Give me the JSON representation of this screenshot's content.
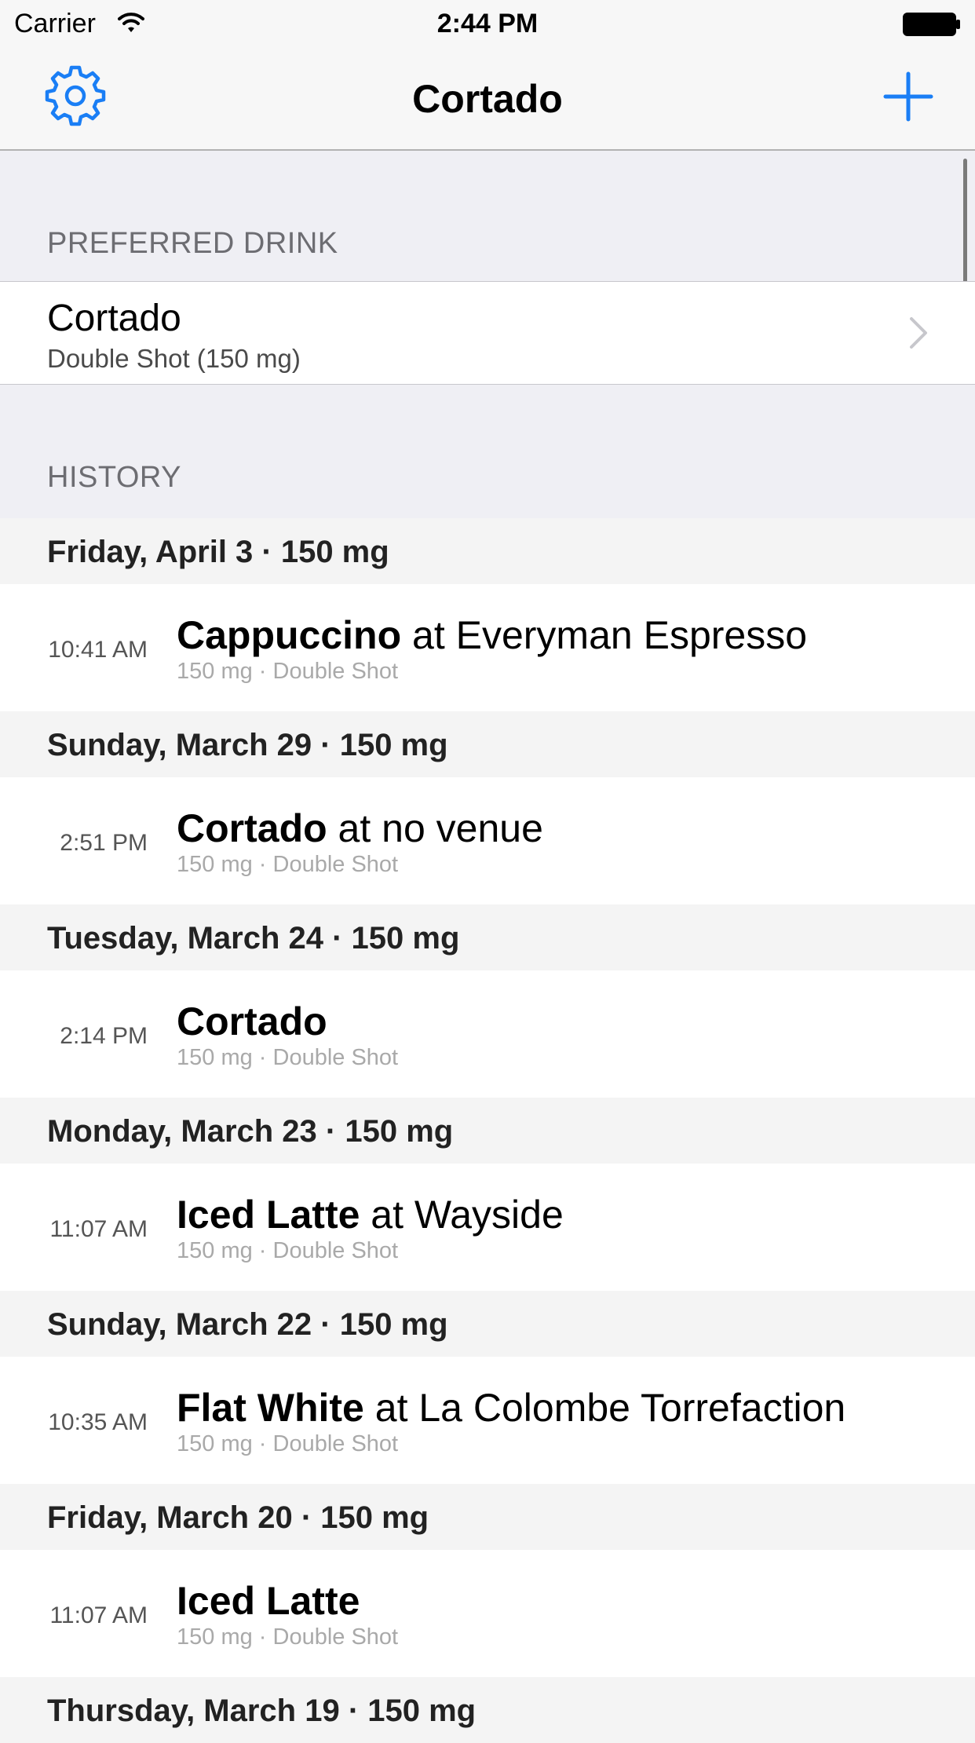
{
  "status_bar": {
    "carrier": "Carrier",
    "time": "2:44 PM"
  },
  "nav": {
    "title": "Cortado"
  },
  "preferred": {
    "section_label": "PREFERRED DRINK",
    "drink_name": "Cortado",
    "drink_detail": "Double Shot (150 mg)"
  },
  "history": {
    "section_label": "HISTORY",
    "days": [
      {
        "header": "Friday, April 3 · 150 mg",
        "entries": [
          {
            "time": "10:41 AM",
            "drink": "Cappuccino",
            "venue": " at Everyman Espresso",
            "detail": "150 mg · Double Shot"
          }
        ]
      },
      {
        "header": "Sunday, March 29 · 150 mg",
        "entries": [
          {
            "time": "2:51 PM",
            "drink": "Cortado",
            "venue": " at no venue",
            "detail": "150 mg · Double Shot"
          }
        ]
      },
      {
        "header": "Tuesday, March 24 · 150 mg",
        "entries": [
          {
            "time": "2:14 PM",
            "drink": "Cortado",
            "venue": "",
            "detail": "150 mg · Double Shot"
          }
        ]
      },
      {
        "header": "Monday, March 23 · 150 mg",
        "entries": [
          {
            "time": "11:07 AM",
            "drink": "Iced Latte",
            "venue": " at Wayside",
            "detail": "150 mg · Double Shot"
          }
        ]
      },
      {
        "header": "Sunday, March 22 · 150 mg",
        "entries": [
          {
            "time": "10:35 AM",
            "drink": "Flat White",
            "venue": " at La Colombe Torrefaction",
            "detail": "150 mg · Double Shot"
          }
        ]
      },
      {
        "header": "Friday, March 20 · 150 mg",
        "entries": [
          {
            "time": "11:07 AM",
            "drink": "Iced Latte",
            "venue": "",
            "detail": "150 mg · Double Shot"
          }
        ]
      },
      {
        "header": "Thursday, March 19 · 150 mg",
        "entries": []
      }
    ]
  },
  "icons": {
    "settings": "gear-icon",
    "add": "plus-icon",
    "disclosure": "chevron-right-icon",
    "wifi": "wifi-icon",
    "battery": "battery-icon"
  },
  "colors": {
    "accent": "#1a7ef5",
    "section_text": "#6d6d72",
    "group_background": "#efeff4",
    "day_header_background": "#f4f4f4"
  }
}
